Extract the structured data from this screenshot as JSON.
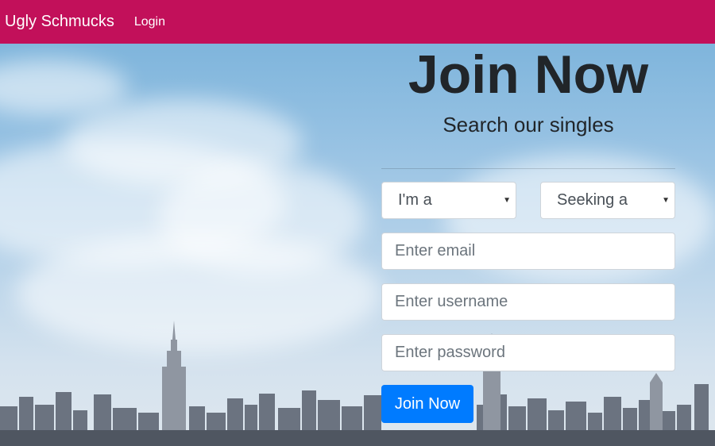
{
  "nav": {
    "brand": "Ugly Schmucks",
    "login": "Login",
    "color": "#c2105a"
  },
  "hero": {
    "title": "Join Now",
    "subtitle": "Search our singles"
  },
  "form": {
    "gender": {
      "selected": "I'm a"
    },
    "seeking": {
      "selected": "Seeking a"
    },
    "email": {
      "placeholder": "Enter email"
    },
    "username": {
      "placeholder": "Enter username"
    },
    "password": {
      "placeholder": "Enter password"
    },
    "submit": {
      "label": "Join Now",
      "color": "#007bff"
    }
  }
}
